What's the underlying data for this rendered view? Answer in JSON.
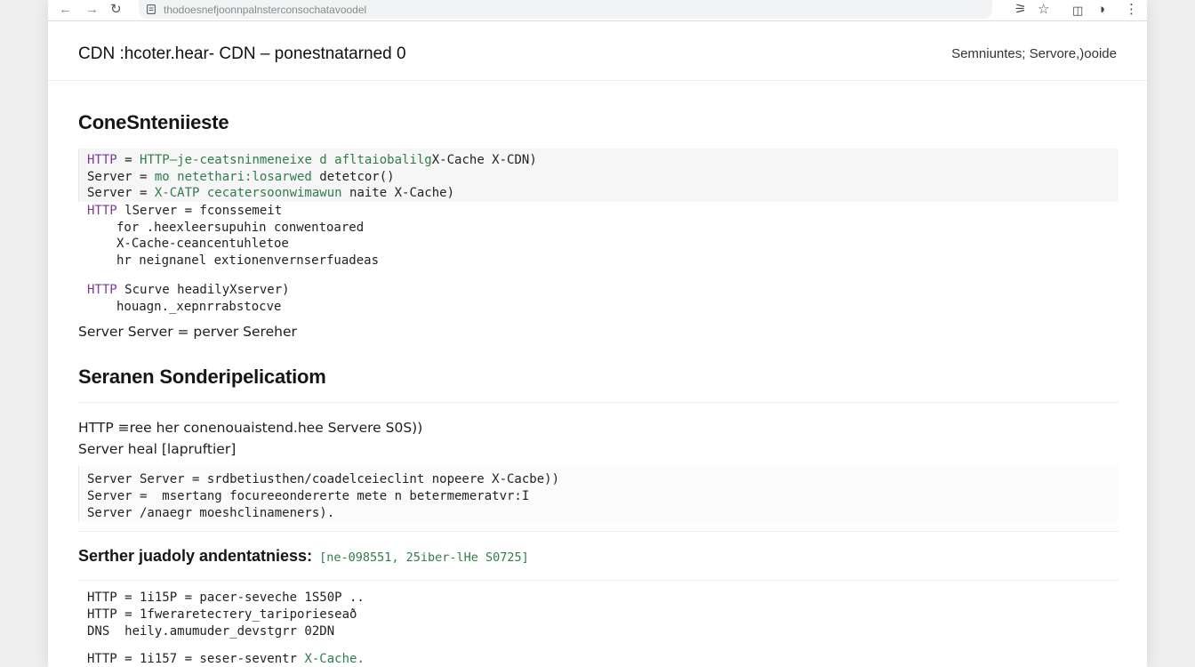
{
  "browser": {
    "url": "thodoesnefjoonnpalnsterconsochatavoodel",
    "colors": {
      "toolbar_bg": "#ffffff",
      "omnibox_bg": "#f1f3f4"
    }
  },
  "header": {
    "title": "CDN :hcoter.hear- CDN – ponestnatarned 0",
    "right_text": "Semniuntes; Servore,)ooide"
  },
  "sections": {
    "s1_title": "ConeSnteniieste",
    "block1": {
      "l1_a": "HTTP",
      "l1_b": " = ",
      "l1_c": "HTTP—je-ceatsninmeneixe d afltaiobalilg",
      "l1_d": "X-Cache X-CDN)",
      "l2_a": "Server = ",
      "l2_b": "mo netethari:losarwed ",
      "l2_c": "detetcor()",
      "l3_a": "Server = ",
      "l3_b": "X-CATP cecatersoonwimawun ",
      "l3_c": "naite X-Cache)"
    },
    "block2": {
      "l1_a": "HTTP",
      "l1_b": " lServer = fconssemeit",
      "l2": "for .heexleersupuhin conwentoared",
      "l3": "X-Cache-ceancentuhletoe",
      "l4": "hr neignanel extionenvernserfuadeas"
    },
    "block3": {
      "l1_a": "HTTP",
      "l1_b": " Scurve headilyXserver)",
      "l2": "houagn._xepnrrabstocve"
    },
    "prose1": "Server Server = perver Sereher",
    "s2_title": "Seranen Sonderipelicatiom",
    "prose2": "HTTP ≡ree her conenouaistend.hee Servere S0S))",
    "prose3": "Server heal [lapruftier]",
    "block4": {
      "l1": "Server Server = srdbetiusthen/coadelceieclint nopeere X-Cacbe))",
      "l2": "Server =  msertang focureeondererte mete n betermemeratvr:I",
      "l3": "Server /anaegr moeshclinameners)."
    },
    "sub_title": "Serther juadoly andentatniess:",
    "sub_tag": "[ne-098551, 25iber-lHe S0725]",
    "block5": {
      "l1": "HTTP = 1i15P = pacer-seveche 1S50P ..",
      "l2": "HTTP = 1fwerareteстery_tariporieseað",
      "l3": "DNS  heily.amumuder_devstgrr 02DN"
    },
    "block6": {
      "l1_a": "HTTP = 1i157 = seser-seventr ",
      "l1_b": "X-Cache."
    }
  }
}
